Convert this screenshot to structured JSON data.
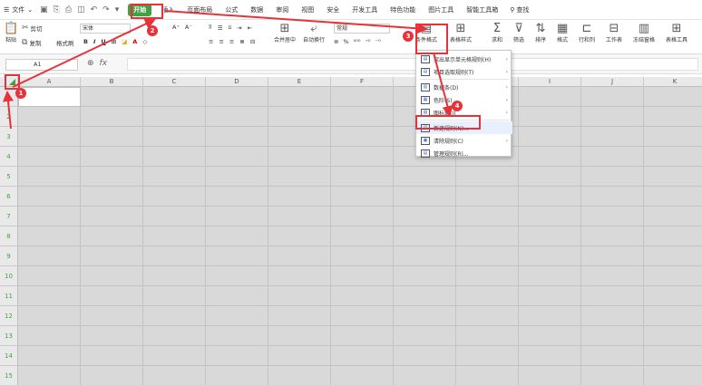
{
  "menubar": {
    "file_label": "文件",
    "tabs": [
      "开始",
      "插入",
      "页面布局",
      "公式",
      "数据",
      "审阅",
      "视图",
      "安全",
      "开发工具",
      "特色功能",
      "图片工具",
      "智能工具箱"
    ],
    "active_tab": "开始",
    "search_label": "查找"
  },
  "ribbon": {
    "paste": "粘贴",
    "cut": "剪切",
    "copy": "复制",
    "format_painter": "格式刷",
    "font_name": "宋体",
    "merge_center": "合并居中",
    "auto_wrap": "自动换行",
    "number_format": "常规",
    "conditional_format": "条件格式",
    "table_style": "表格样式",
    "sum": "求和",
    "filter": "筛选",
    "sort": "排序",
    "format": "格式",
    "row_col": "行和列",
    "worksheet": "工作表",
    "freeze": "冻结窗格",
    "table_tools": "表格工具"
  },
  "formula_bar": {
    "cell_ref": "A1",
    "fx": "fx"
  },
  "grid": {
    "columns": [
      "A",
      "B",
      "C",
      "D",
      "E",
      "F",
      "G",
      "H",
      "I",
      "J",
      "K"
    ],
    "rows": [
      "1",
      "2",
      "3",
      "4",
      "5",
      "6",
      "7",
      "8",
      "9",
      "10",
      "11",
      "12",
      "13",
      "14",
      "15"
    ]
  },
  "dropdown": {
    "items": [
      {
        "label": "突出显示单元格规则(H)",
        "submenu": true
      },
      {
        "label": "项目选取规则(T)",
        "submenu": true
      },
      {
        "label": "数据条(D)",
        "submenu": true
      },
      {
        "label": "色阶(S)",
        "submenu": true
      },
      {
        "label": "图标集(I)",
        "submenu": true
      },
      {
        "label": "新建规则(N)...",
        "submenu": false
      },
      {
        "label": "清除规则(C)",
        "submenu": true
      },
      {
        "label": "管理规则(R)...",
        "submenu": false
      }
    ]
  },
  "markers": [
    "1",
    "2",
    "3",
    "4"
  ],
  "colors": {
    "accent": "#3fa142",
    "annotation": "#e8323a"
  }
}
